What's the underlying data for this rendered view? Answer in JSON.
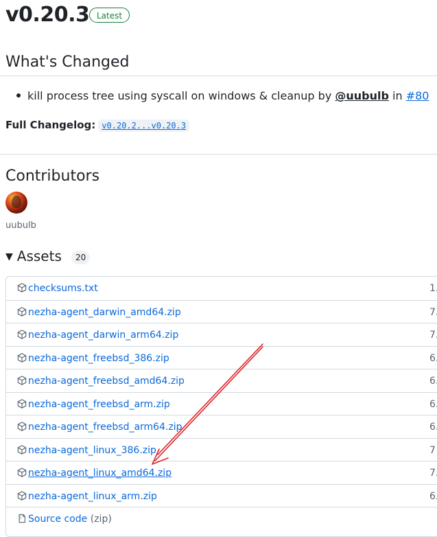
{
  "release": {
    "title": "v0.20.3",
    "badge": "Latest"
  },
  "whats_changed": {
    "title": "What's Changed",
    "items": [
      {
        "text": "kill process tree using syscall on windows & cleanup by ",
        "author": "@uubulb",
        "joiner": " in ",
        "pr": "#80"
      }
    ],
    "full_changelog_label": "Full Changelog:",
    "full_changelog_link": "v0.20.2...v0.20.3"
  },
  "contributors": {
    "title": "Contributors",
    "users": [
      {
        "name": "uubulb"
      }
    ]
  },
  "assets": {
    "title": "Assets",
    "count": "20",
    "items": [
      {
        "name": "checksums.txt",
        "size": "1."
      },
      {
        "name": "nezha-agent_darwin_amd64.zip",
        "size": "7."
      },
      {
        "name": "nezha-agent_darwin_arm64.zip",
        "size": "7."
      },
      {
        "name": "nezha-agent_freebsd_386.zip",
        "size": "6."
      },
      {
        "name": "nezha-agent_freebsd_amd64.zip",
        "size": "6."
      },
      {
        "name": "nezha-agent_freebsd_arm.zip",
        "size": "6."
      },
      {
        "name": "nezha-agent_freebsd_arm64.zip",
        "size": "6."
      },
      {
        "name": "nezha-agent_linux_386.zip",
        "size": "7"
      },
      {
        "name": "nezha-agent_linux_amd64.zip",
        "size": "7."
      },
      {
        "name": "nezha-agent_linux_arm.zip",
        "size": "6."
      },
      {
        "name": "Source code",
        "note": "(zip)",
        "size": ""
      }
    ]
  },
  "colors": {
    "link": "#0969da",
    "latest_badge": "#1a7f37",
    "annotation_arrow": "#e0232b",
    "border": "#d1d9e0"
  },
  "icons": {
    "asset": "package-icon",
    "assets_toggle": "triangle-down-icon",
    "source": "file-zip-icon"
  }
}
